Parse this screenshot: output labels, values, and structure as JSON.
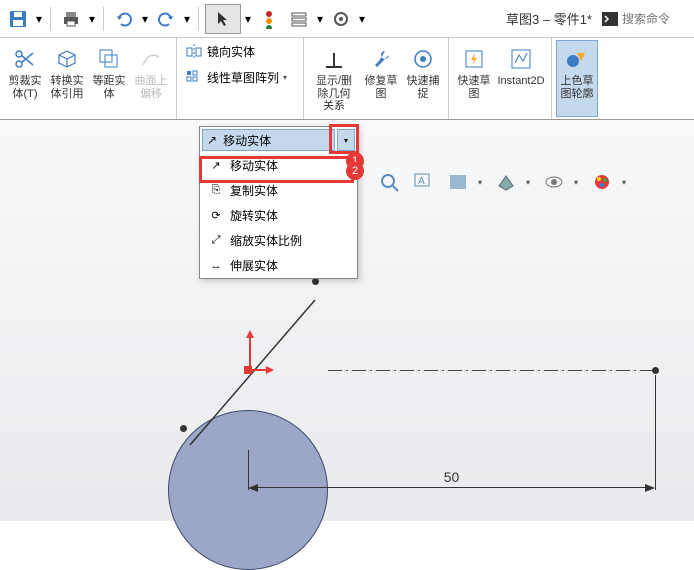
{
  "title": "草图3 – 零件1*",
  "search": {
    "placeholder": "搜索命令"
  },
  "ribbon": {
    "trim": "剪裁实\n体(T)",
    "convert": "转换实\n体引用",
    "offset": "等距实\n体",
    "curve_offset": "曲面上\n偏移",
    "mirror": "镜向实体",
    "pattern": "线性草图阵列",
    "show_rel": "显示/删\n除几何\n关系",
    "repair": "修复草\n图",
    "snap": "快速捕\n捉",
    "quick_sketch": "快速草\n图",
    "instant2d": "Instant2D",
    "shaded": "上色草\n图轮廓"
  },
  "dropdown": {
    "header": "移动实体",
    "items": [
      "移动实体",
      "复制实体",
      "旋转实体",
      "缩放实体比例",
      "伸展实体"
    ]
  },
  "annotations": {
    "n1": "1",
    "n2": "2"
  },
  "dimension": "50"
}
